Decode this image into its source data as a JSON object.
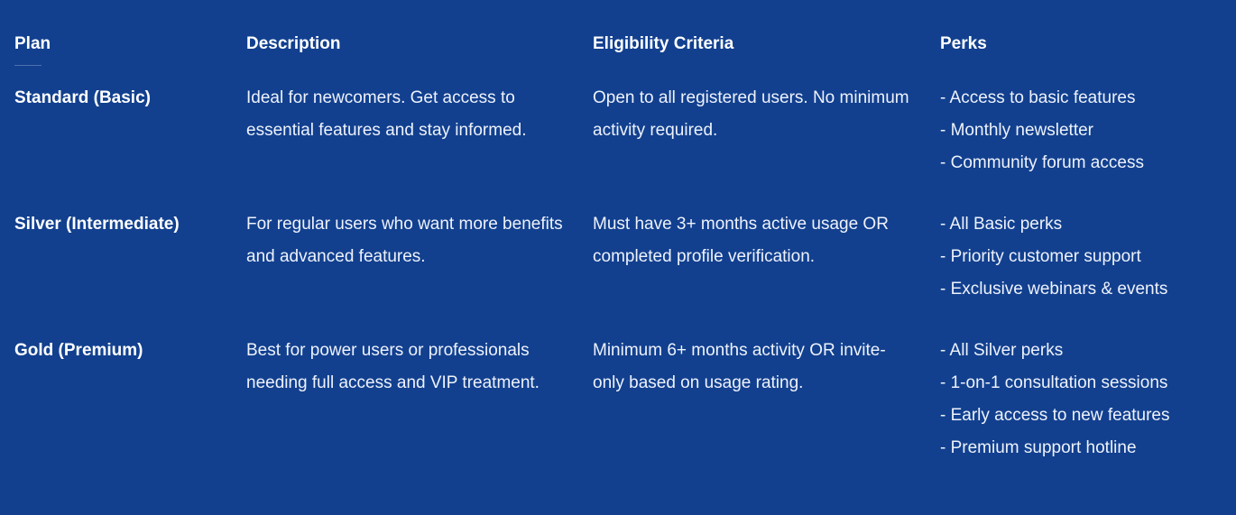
{
  "table": {
    "headers": {
      "plan": "Plan",
      "description": "Description",
      "eligibility": "Eligibility Criteria",
      "perks": "Perks"
    },
    "rows": [
      {
        "plan": "Standard (Basic)",
        "description": "Ideal for newcomers. Get access to essential features and stay informed.",
        "eligibility": "Open to all registered users. No minimum activity required.",
        "perks": [
          "- Access to basic features",
          "- Monthly newsletter",
          "- Community forum access"
        ]
      },
      {
        "plan": "Silver (Intermediate)",
        "description": "For regular users who want more benefits and advanced features.",
        "eligibility": "Must have 3+ months active usage OR completed profile verification.",
        "perks": [
          "- All Basic perks",
          "- Priority customer support",
          "- Exclusive webinars & events"
        ]
      },
      {
        "plan": "Gold (Premium)",
        "description": "Best for power users or professionals needing full access and VIP treatment.",
        "eligibility": "Minimum 6+ months activity OR invite-only based on usage rating.",
        "perks": [
          "- All Silver perks",
          "- 1-on-1 consultation sessions",
          "- Early access to new features",
          "- Premium support hotline"
        ]
      }
    ]
  },
  "colors": {
    "background": "#12408f",
    "text": "#ffffff"
  }
}
